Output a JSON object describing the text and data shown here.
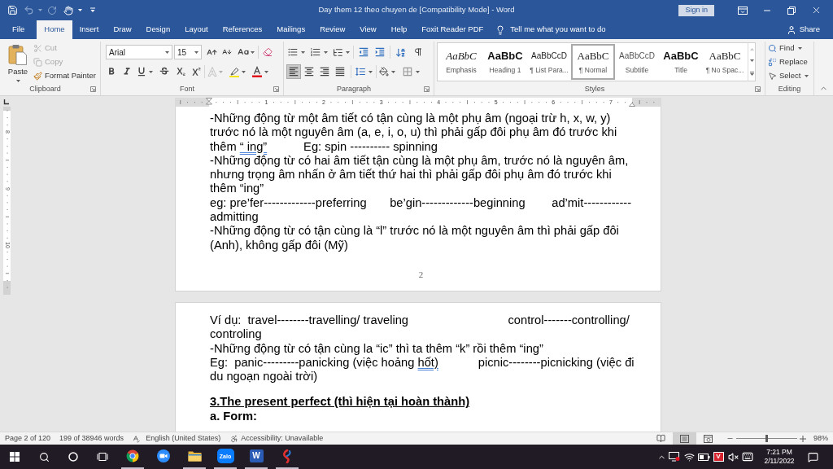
{
  "window": {
    "title": "Day them 12 theo chuyen de [Compatibility Mode] - Word",
    "sign_in": "Sign in"
  },
  "quick_access": [
    {
      "kind": "save",
      "disabled": false
    },
    {
      "kind": "undo",
      "disabled": true
    },
    {
      "kind": "redo",
      "disabled": true
    },
    {
      "kind": "touch",
      "disabled": false
    }
  ],
  "tabs": [
    {
      "label": "File",
      "selected": false
    },
    {
      "label": "Home",
      "selected": true
    },
    {
      "label": "Insert",
      "selected": false
    },
    {
      "label": "Draw",
      "selected": false
    },
    {
      "label": "Design",
      "selected": false
    },
    {
      "label": "Layout",
      "selected": false
    },
    {
      "label": "References",
      "selected": false
    },
    {
      "label": "Mailings",
      "selected": false
    },
    {
      "label": "Review",
      "selected": false
    },
    {
      "label": "View",
      "selected": false
    },
    {
      "label": "Help",
      "selected": false
    },
    {
      "label": "Foxit Reader PDF",
      "selected": false
    }
  ],
  "tell_me": {
    "placeholder": "Tell me what you want to do"
  },
  "share": "Share",
  "clipboard": {
    "title": "Clipboard",
    "paste": "Paste",
    "commands": [
      {
        "kind": "cut",
        "label": "Cut",
        "disabled": true
      },
      {
        "kind": "copy",
        "label": "Copy",
        "disabled": true
      },
      {
        "kind": "painter",
        "label": "Format Painter",
        "disabled": false
      }
    ]
  },
  "font": {
    "title": "Font",
    "name": "Arial",
    "size": "15",
    "text_effects": {
      "disabled": true
    }
  },
  "paragraph": {
    "title": "Paragraph",
    "alignments": [
      {
        "kind": "left",
        "selected": true
      },
      {
        "kind": "center",
        "selected": false
      },
      {
        "kind": "right",
        "selected": false
      },
      {
        "kind": "justify",
        "selected": false
      }
    ]
  },
  "styles": {
    "title": "Styles",
    "items": [
      {
        "kind": "emphasis",
        "preview": "AaBbC",
        "caption": "Emphasis",
        "selected": false
      },
      {
        "kind": "heading",
        "preview": "AaBbC",
        "caption": "Heading 1",
        "selected": false
      },
      {
        "kind": "list",
        "preview": "AaBbCcD",
        "caption": "¶ List Para...",
        "selected": false
      },
      {
        "kind": "normal",
        "preview": "AaBbC",
        "caption": "¶ Normal",
        "selected": true
      },
      {
        "kind": "subtitle",
        "preview": "AaBbCcD",
        "caption": "Subtitle",
        "selected": false
      },
      {
        "kind": "title",
        "preview": "AaBbC",
        "caption": "Title",
        "selected": false
      },
      {
        "kind": "nospacing",
        "preview": "AaBbC",
        "caption": "¶ No Spac...",
        "selected": false
      }
    ]
  },
  "editing": {
    "title": "Editing",
    "commands": [
      {
        "kind": "find",
        "label": "Find"
      },
      {
        "kind": "replace",
        "label": "Replace"
      },
      {
        "kind": "select",
        "label": "Select"
      }
    ]
  },
  "ruler": {
    "numbers": [
      "1",
      "2",
      "3",
      "4",
      "5",
      "6",
      "7"
    ]
  },
  "vertical_ruler": {
    "numbers": [
      "8",
      "9",
      "10"
    ]
  },
  "pages": [
    {
      "paragraphs": [
        {
          "kind": "body",
          "runs": [
            {
              "text": "-Những động từ một âm tiết có tận cùng là một phụ âm (ngoại trừ h, x, w, y) trước nó là một nguyên âm (a, e, i, o, u) thì phải gấp đôi phụ âm đó trước khi thêm ",
              "flagged": false
            },
            {
              "text": "“ ing”",
              "flagged": true
            },
            {
              "text": "           Eg: spin ---------- spinning",
              "flagged": false
            }
          ]
        },
        {
          "kind": "body",
          "text": "-Những động từ có hai âm tiết tận cùng là một phụ âm, trước nó là nguyên âm, nhưng trọng âm nhấn ở âm tiết thứ hai thì phải gấp đôi phụ âm đó trước khi thêm “ing”"
        },
        {
          "kind": "body",
          "text": "eg: pre’fer-------------preferring       be’gin-------------beginning        ad’mit------------admitting"
        },
        {
          "kind": "body",
          "text": "-Những động từ có tận cùng là “l” trước nó là một nguyên âm thì phải gấp đôi (Anh), không gấp đôi (Mỹ)"
        }
      ],
      "page_number": "2"
    },
    {
      "paragraphs": [
        {
          "kind": "body",
          "text": "Ví dụ:  travel--------travelling/ traveling                              control-------controlling/ controling"
        },
        {
          "kind": "body",
          "text": "-Những động từ có tận cùng la “ic” thì ta thêm “k” rồi thêm “ing”"
        },
        {
          "kind": "body",
          "runs": [
            {
              "text": "Eg:  panic---------panicking (việc hoảng ",
              "flagged": false
            },
            {
              "text": "hốt)",
              "flagged": true
            },
            {
              "text": "            picnic--------picnicking (việc đi du ngoạn ngoài trời)",
              "flagged": false
            }
          ]
        },
        {
          "kind": "heading",
          "text": "3.The present perfect (thì hiện tại hoàn thành)"
        },
        {
          "kind": "label",
          "text": "a. Form:"
        }
      ]
    }
  ],
  "status_bar": {
    "page": "Page 2 of 120",
    "words": "199 of 38946 words",
    "language": "English (United States)",
    "accessibility": "Accessibility: Unavailable",
    "views": [
      {
        "kind": "read",
        "selected": false
      },
      {
        "kind": "print",
        "selected": true
      },
      {
        "kind": "web",
        "selected": false
      }
    ],
    "zoom": {
      "level": 0.5,
      "reading": "98%"
    }
  },
  "taskbar": {
    "apps": [
      {
        "kind": "chrome",
        "running": true
      },
      {
        "kind": "zoom",
        "running": false
      },
      {
        "kind": "explorer",
        "running": true
      },
      {
        "kind": "zalo",
        "glyph": "Zalo",
        "running": true
      },
      {
        "kind": "word",
        "glyph": "W",
        "running": true
      },
      {
        "kind": "swirl",
        "running": true
      }
    ],
    "tray": [
      {
        "kind": "screen"
      },
      {
        "kind": "wifi"
      },
      {
        "kind": "battery"
      },
      {
        "kind": "ime",
        "glyph": "V"
      },
      {
        "kind": "muted"
      },
      {
        "kind": "keyboard"
      }
    ],
    "time": "7:21 PM",
    "date": "2/11/2022"
  }
}
